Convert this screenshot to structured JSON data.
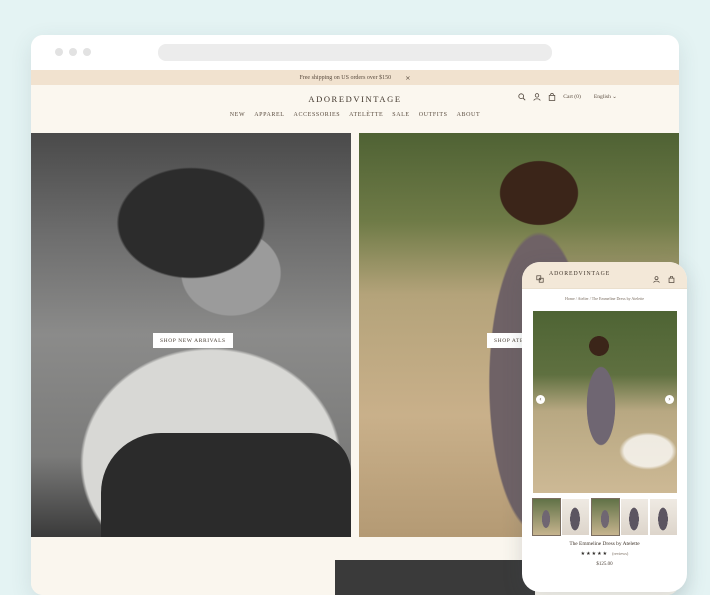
{
  "announcement": {
    "text": "Free shipping on US orders over $150",
    "close": "×"
  },
  "site": {
    "logo": "ADOREDVINTAGE",
    "cart_label": "Cart (0)",
    "language": "English ⌄"
  },
  "nav": {
    "items": [
      "NEW",
      "APPAREL",
      "ACCESSORIES",
      "ATELÈTTE",
      "SALE",
      "OUTFITS",
      "ABOUT"
    ]
  },
  "hero": {
    "left_cta": "SHOP NEW ARRIVALS",
    "right_cta": "SHOP ATE"
  },
  "mobile": {
    "logo": "ADOREDVINTAGE",
    "breadcrumb": "Home / Atelier / The Emmeline Dress by Atelette",
    "product_title": "The Emmeline Dress by Atelette",
    "stars": "★★★★★",
    "reviews": "(reviews)",
    "price": "$125.00",
    "prev": "‹",
    "next": "›"
  }
}
